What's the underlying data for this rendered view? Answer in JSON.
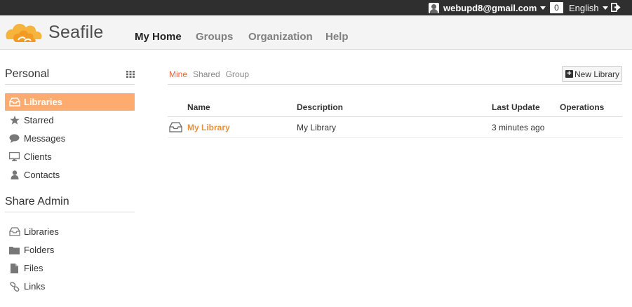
{
  "topbar": {
    "user_email": "webupd8@gmail.com",
    "notification_count": "0",
    "language": "English"
  },
  "header": {
    "brand": "Seafile",
    "nav": [
      "My Home",
      "Groups",
      "Organization",
      "Help"
    ],
    "active_nav": "My Home"
  },
  "sidebar": {
    "personal_title": "Personal",
    "personal_items": [
      {
        "label": "Libraries",
        "icon": "library-icon",
        "active": true
      },
      {
        "label": "Starred",
        "icon": "star-icon"
      },
      {
        "label": "Messages",
        "icon": "chat-bubble-icon"
      },
      {
        "label": "Clients",
        "icon": "monitor-icon"
      },
      {
        "label": "Contacts",
        "icon": "user-icon"
      }
    ],
    "share_admin_title": "Share Admin",
    "share_admin_items": [
      {
        "label": "Libraries",
        "icon": "library-icon"
      },
      {
        "label": "Folders",
        "icon": "folder-icon"
      },
      {
        "label": "Files",
        "icon": "file-icon"
      },
      {
        "label": "Links",
        "icon": "link-icon"
      }
    ]
  },
  "main": {
    "tabs": [
      "Mine",
      "Shared",
      "Group"
    ],
    "active_tab": "Mine",
    "new_library_label": "New Library",
    "columns": [
      "Name",
      "Description",
      "Last Update",
      "Operations"
    ],
    "rows": [
      {
        "name": "My Library",
        "description": "My Library",
        "last_update": "3 minutes ago",
        "operations": ""
      }
    ]
  },
  "colors": {
    "accent_orange": "#fdab6e",
    "link_orange": "#e8913a",
    "active_tab_red": "#e6633d",
    "topbar_bg": "#2f2f2f"
  }
}
